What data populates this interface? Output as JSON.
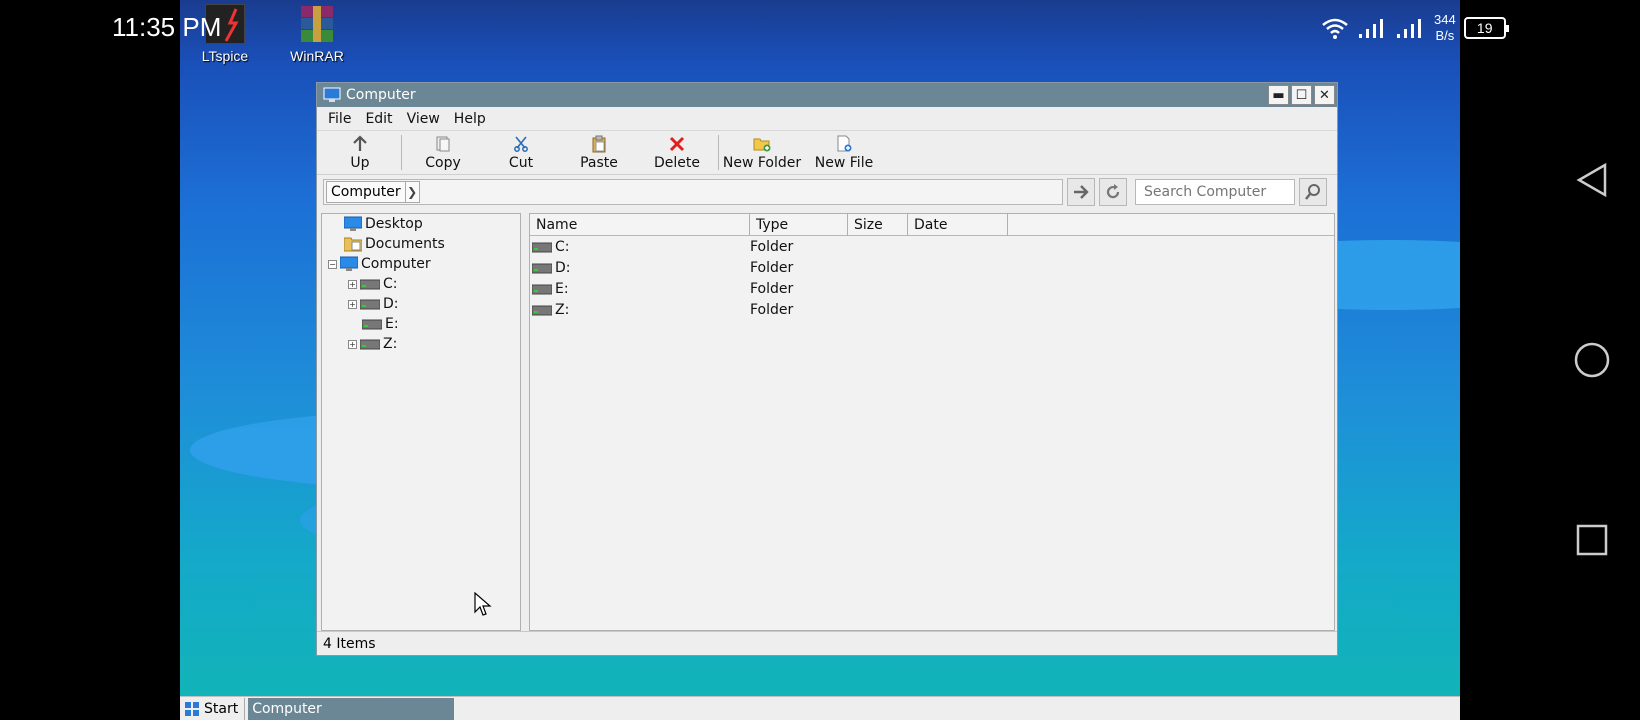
{
  "status_bar": {
    "time": "11:35 PM",
    "speed_value": "344",
    "speed_unit": "B/s",
    "battery": "19"
  },
  "desktop_icons": [
    {
      "label": "LTspice"
    },
    {
      "label": "WinRAR"
    }
  ],
  "window": {
    "title": "Computer",
    "menu": [
      "File",
      "Edit",
      "View",
      "Help"
    ],
    "toolbar": {
      "up": "Up",
      "copy": "Copy",
      "cut": "Cut",
      "paste": "Paste",
      "delete": "Delete",
      "new_folder": "New Folder",
      "new_file": "New File"
    },
    "breadcrumb": "Computer",
    "search_placeholder": "Search Computer",
    "tree": {
      "desktop": "Desktop",
      "documents": "Documents",
      "computer": "Computer",
      "drives": [
        "C:",
        "D:",
        "E:",
        "Z:"
      ]
    },
    "columns": [
      "Name",
      "Type",
      "Size",
      "Date"
    ],
    "rows": [
      {
        "name": "C:",
        "type": "Folder"
      },
      {
        "name": "D:",
        "type": "Folder"
      },
      {
        "name": "E:",
        "type": "Folder"
      },
      {
        "name": "Z:",
        "type": "Folder"
      }
    ],
    "status": "4 Items"
  },
  "taskbar": {
    "start": "Start",
    "task": "Computer"
  }
}
